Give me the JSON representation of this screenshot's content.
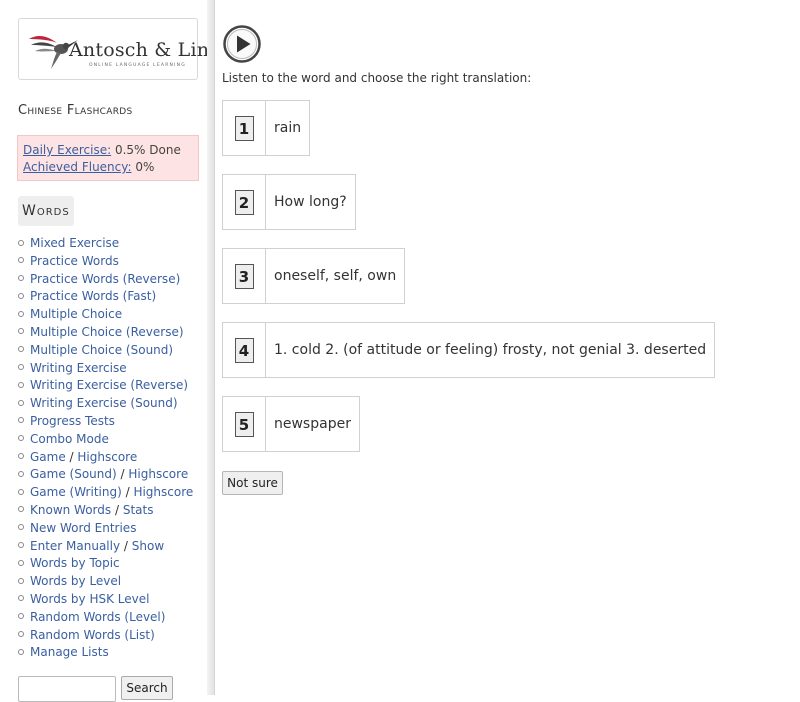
{
  "logo": {
    "text": "Antosch & Lin",
    "subtitle": "ONLINE LANGUAGE LEARNING"
  },
  "sidebar": {
    "title": "Chinese Flashcards",
    "progress": {
      "daily_label": "Daily Exercise:",
      "daily_value": " 0.5% Done",
      "fluency_label": "Achieved Fluency:",
      "fluency_value": " 0%"
    },
    "words_header": "Words",
    "menu": [
      {
        "a": "Mixed Exercise"
      },
      {
        "a": "Practice Words"
      },
      {
        "a": "Practice Words (Reverse)"
      },
      {
        "a": "Practice Words (Fast)"
      },
      {
        "a": "Multiple Choice"
      },
      {
        "a": "Multiple Choice (Reverse)"
      },
      {
        "a": "Multiple Choice (Sound)"
      },
      {
        "a": "Writing Exercise"
      },
      {
        "a": "Writing Exercise (Reverse)"
      },
      {
        "a": "Writing Exercise (Sound)"
      },
      {
        "a": "Progress Tests"
      },
      {
        "a": "Combo Mode"
      },
      {
        "a": "Game",
        "b": "Highscore"
      },
      {
        "a": "Game (Sound)",
        "b": "Highscore"
      },
      {
        "a": "Game (Writing)",
        "b": "Highscore"
      },
      {
        "a": "Known Words",
        "b": "Stats"
      },
      {
        "a": "New Word Entries"
      },
      {
        "a": "Enter Manually",
        "b": "Show"
      },
      {
        "a": "Words by Topic"
      },
      {
        "a": "Words by Level"
      },
      {
        "a": "Words by HSK Level"
      },
      {
        "a": "Random Words (Level)"
      },
      {
        "a": "Random Words (List)"
      },
      {
        "a": "Manage Lists"
      }
    ],
    "separator": " / ",
    "search": {
      "value": "",
      "button": "Search"
    }
  },
  "main": {
    "play_icon": "play-icon",
    "instruction": "Listen to the word and choose the right translation:",
    "options": [
      {
        "num": "1",
        "text": "rain"
      },
      {
        "num": "2",
        "text": "How long?"
      },
      {
        "num": "3",
        "text": "oneself, self, own"
      },
      {
        "num": "4",
        "text": "1. cold 2. (of attitude or feeling) frosty, not genial 3. deserted"
      },
      {
        "num": "5",
        "text": "newspaper"
      }
    ],
    "not_sure": "Not sure"
  },
  "colors": {
    "link": "#3a5fa0",
    "progress_bg": "#fde3e3",
    "logo_accent": "#c0253a"
  }
}
